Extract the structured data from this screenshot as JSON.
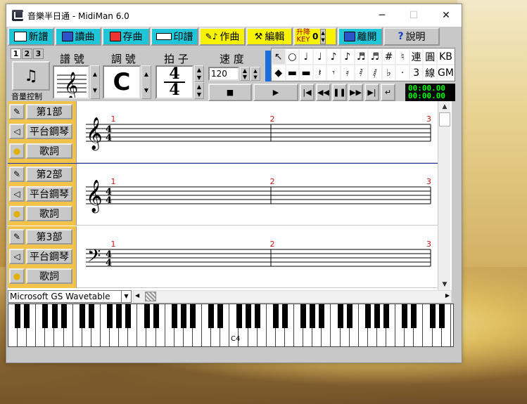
{
  "window": {
    "title": "音樂半日通 - MidiMan 6.0",
    "minimize": "─",
    "maximize": "☐",
    "close": "✕"
  },
  "toolbar": {
    "new": "新譜",
    "read": "讀曲",
    "save": "存曲",
    "print": "印譜",
    "compose": "作曲",
    "edit": "編輯",
    "key_label_top": "升降",
    "key_label_bottom": "KEY",
    "key_value": "0",
    "exit": "離開",
    "help": "說明",
    "help_icon": "?"
  },
  "score_controls": {
    "tabs": [
      "1",
      "2",
      "3"
    ],
    "volume_label": "音量控制",
    "clef_label": "譜 號",
    "key_sig_label": "調 號",
    "key_sig_value": "C",
    "time_label": "拍 子",
    "time_num": "4",
    "time_den": "4",
    "tempo_label": "速 度",
    "tempo_value": "120"
  },
  "palette": {
    "row1": [
      "↖",
      "○",
      "♩",
      "♩",
      "♪",
      "♪",
      "♬",
      "♬",
      "#",
      "♮",
      "連",
      "圓",
      "KB"
    ],
    "row2": [
      "◆",
      "▬",
      "▬",
      "𝄽",
      "𝄾",
      "𝄿",
      "𝅀",
      "𝅁",
      "♭",
      "·",
      "3",
      "線",
      "GM"
    ]
  },
  "transport": {
    "stop": "■",
    "play": "▶",
    "first": "|◀",
    "rew": "◀◀",
    "pause": "❚❚",
    "ff": "▶▶",
    "last": "▶|",
    "loop": "↵",
    "time1": "00:00.00",
    "time2": "00:00.00"
  },
  "parts": [
    {
      "part_label": "第1部",
      "instrument": "平台鋼琴",
      "lyrics": "歌詞",
      "clef": "treble",
      "measures": [
        "1",
        "2",
        "3"
      ]
    },
    {
      "part_label": "第2部",
      "instrument": "平台鋼琴",
      "lyrics": "歌詞",
      "clef": "treble",
      "measures": [
        "1",
        "2",
        "3"
      ]
    },
    {
      "part_label": "第3部",
      "instrument": "平台鋼琴",
      "lyrics": "歌詞",
      "clef": "bass",
      "measures": [
        "1",
        "2",
        "3"
      ]
    }
  ],
  "device": {
    "selected": "Microsoft GS Wavetable Synt"
  },
  "keyboard": {
    "middle_c": "C4"
  },
  "colors": {
    "cyan_btn": "#1fc6d8",
    "yellow_btn": "#f6f200",
    "part_panel": "#f1c348",
    "measure_number": "#d01010",
    "lcd_text": "#00ff00"
  }
}
